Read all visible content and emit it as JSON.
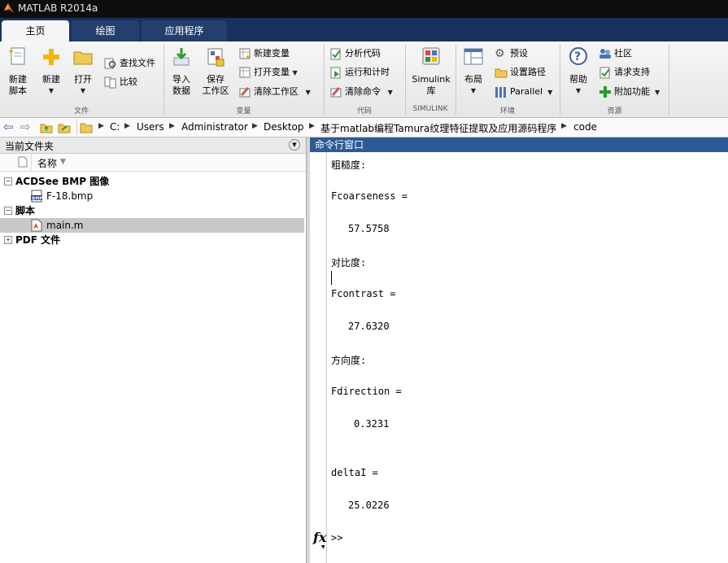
{
  "window": {
    "title": "MATLAB R2014a"
  },
  "tabs": [
    {
      "label": "主页",
      "active": true
    },
    {
      "label": "绘图",
      "active": false
    },
    {
      "label": "应用程序",
      "active": false
    }
  ],
  "ribbon": {
    "file_group": {
      "label": "文件",
      "new_script": "新建\n脚本",
      "new": "新建",
      "open": "打开",
      "find_files": "查找文件",
      "compare": "比较"
    },
    "variable_group": {
      "label": "变量",
      "import_data": "导入\n数据",
      "save_workspace": "保存\n工作区",
      "new_variable": "新建变量",
      "open_variable": "打开变量",
      "clear_workspace": "清除工作区"
    },
    "code_group": {
      "label": "代码",
      "analyze_code": "分析代码",
      "run_and_time": "运行和计时",
      "clear_commands": "清除命令"
    },
    "simulink_group": {
      "label": "SIMULINK",
      "simulink_library": "Simulink\n库"
    },
    "environment_group": {
      "label": "环境",
      "layout": "布局",
      "preferences": "预设",
      "set_path": "设置路径",
      "parallel": "Parallel"
    },
    "resources_group": {
      "label": "资源",
      "help": "帮助",
      "community": "社区",
      "request_support": "请求支持",
      "add_ons": "附加功能"
    }
  },
  "address_bar": {
    "path": [
      "C:",
      "Users",
      "Administrator",
      "Desktop",
      "基于matlab编程Tamura纹理特征提取及应用源码程序",
      "code"
    ]
  },
  "current_folder": {
    "title": "当前文件夹",
    "column_name": "名称",
    "groups": [
      {
        "label": "ACDSee BMP 图像",
        "expanded": true,
        "items": [
          {
            "name": "F-18.bmp",
            "icon": "bmp-file-icon"
          }
        ]
      },
      {
        "label": "脚本",
        "expanded": true,
        "items": [
          {
            "name": "main.m",
            "icon": "matlab-script-icon",
            "selected": true
          }
        ]
      },
      {
        "label": "PDF 文件",
        "expanded": false,
        "items": []
      }
    ]
  },
  "command_window": {
    "title": "命令行窗口",
    "lines": [
      "粗糙度:",
      "Fcoarseness =",
      "57.5758",
      "对比度:",
      "Fcontrast =",
      "27.6320",
      "方向度:",
      "Fdirection =",
      "0.3231",
      "deltaI =",
      "25.0226"
    ],
    "prompt": ">>",
    "fx": "fx"
  },
  "colors": {
    "titlebar": "#0d0d0d",
    "tabstrip": "#19325d",
    "cmd_header": "#2d5a96",
    "selected_row": "#c8c8c8"
  }
}
